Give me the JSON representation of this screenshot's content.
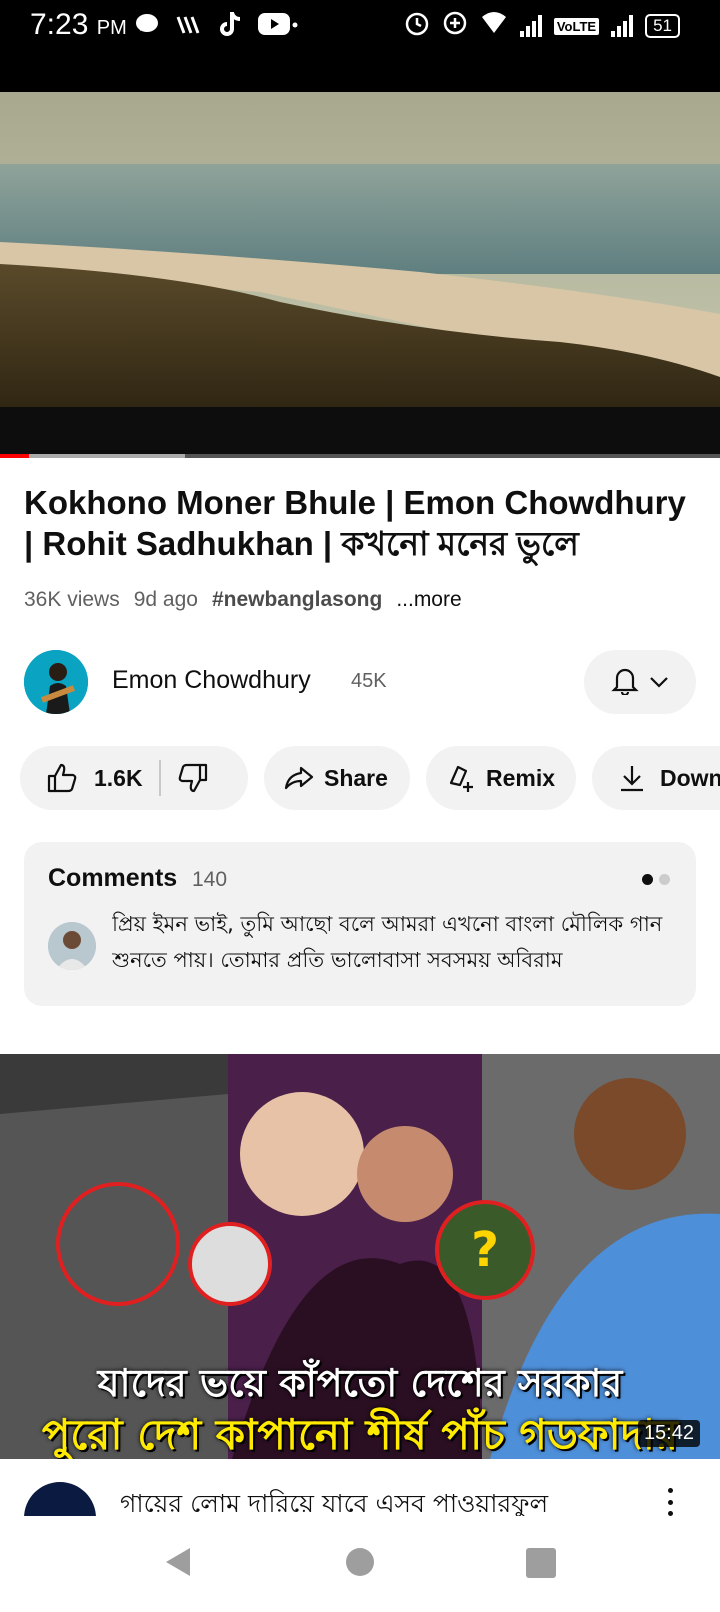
{
  "status_bar": {
    "time": "7:23",
    "ampm": "PM",
    "volte": "VoLTE",
    "battery": "51"
  },
  "video": {
    "title": "Kokhono Moner Bhule | Emon Chowdhury | Rohit Sadhukhan | কখনো মনের ভুলে",
    "views": "36K views",
    "age": "9d ago",
    "hashtag": "#newbanglasong",
    "more": "...more",
    "progress_fraction": 0.04
  },
  "channel": {
    "name": "Emon Chowdhury",
    "subscribers": "45K"
  },
  "actions": {
    "likes": "1.6K",
    "share": "Share",
    "remix": "Remix",
    "download": "Down"
  },
  "comments": {
    "title": "Comments",
    "count": "140",
    "top_comment": "প্রিয় ইমন ভাই, তুমি আছো বলে আমরা এখনো বাংলা মৌলিক গান শুনতে পায়। তোমার প্রতি ভালোবাসা সবসময় অবিরাম"
  },
  "next_video": {
    "caption_line1": "যাদের ভয়ে কাঁপতো দেশের সরকার",
    "caption_line2": "পুরো দেশ কাপানো শীর্ষ পাঁচ গডফাদার",
    "duration": "15:42",
    "title": "গায়ের লোম দারিয়ে যাবে এসব পাওয়ারফুল"
  },
  "icons": [
    "whatsapp-icon",
    "wifi-calling-icon",
    "tiktok-icon",
    "youtube-icon",
    "alarm-icon",
    "data-saver-icon",
    "wifi-icon",
    "signal-icon",
    "battery-icon",
    "like-icon",
    "dislike-icon",
    "share-icon",
    "remix-icon",
    "download-icon",
    "bell-icon",
    "chevron-down-icon",
    "kebab-menu-icon",
    "back-icon",
    "home-icon",
    "recents-icon"
  ]
}
